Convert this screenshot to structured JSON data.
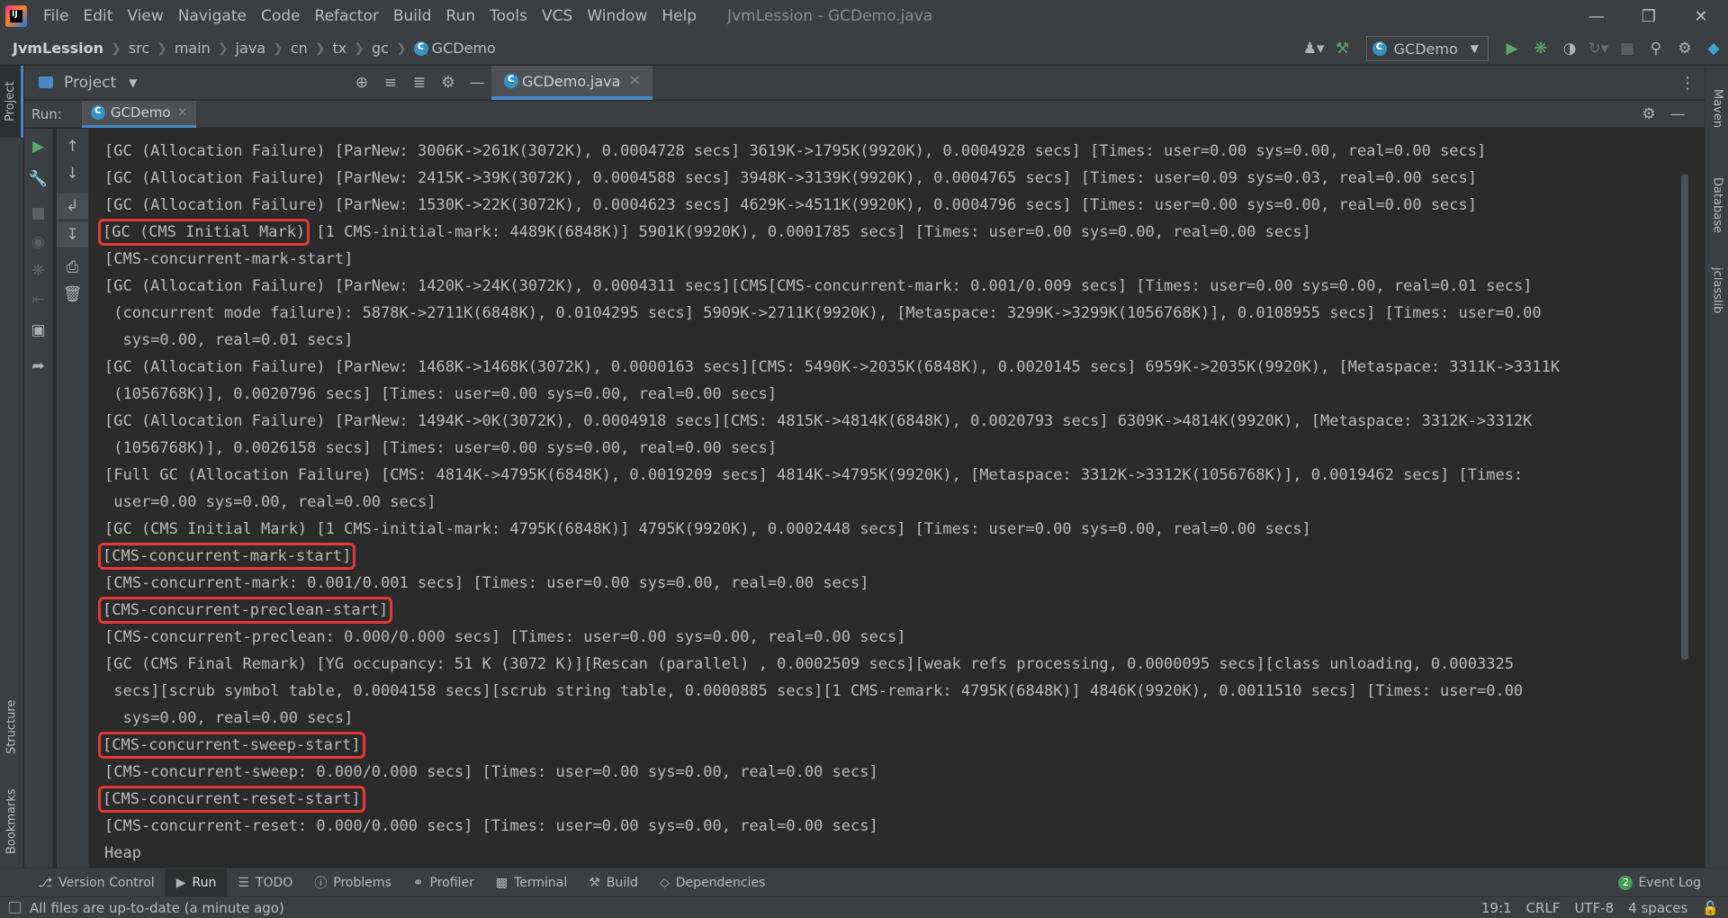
{
  "menu": [
    "File",
    "Edit",
    "View",
    "Navigate",
    "Code",
    "Refactor",
    "Build",
    "Run",
    "Tools",
    "VCS",
    "Window",
    "Help"
  ],
  "window_title": "JvmLession - GCDemo.java",
  "breadcrumb": [
    "JvmLession",
    "src",
    "main",
    "java",
    "cn",
    "tx",
    "gc",
    "GCDemo"
  ],
  "run_config": "GCDemo",
  "project_panel": {
    "title": "Project"
  },
  "editor": {
    "tab": "GCDemo.java"
  },
  "run_window": {
    "label": "Run:",
    "tab": "GCDemo"
  },
  "left_stripe": {
    "project": "Project",
    "structure": "Structure",
    "bookmarks": "Bookmarks"
  },
  "right_stripe": {
    "maven": "Maven",
    "database": "Database",
    "jclasslib": "jclasslib"
  },
  "console": {
    "lines": [
      "[GC (Allocation Failure) [ParNew: 3006K->261K(3072K), 0.0004728 secs] 3619K->1795K(9920K), 0.0004928 secs] [Times: user=0.00 sys=0.00, real=0.00 secs]",
      "[GC (Allocation Failure) [ParNew: 2415K->39K(3072K), 0.0004588 secs] 3948K->3139K(9920K), 0.0004765 secs] [Times: user=0.09 sys=0.03, real=0.00 secs]",
      "[GC (Allocation Failure) [ParNew: 1530K->22K(3072K), 0.0004623 secs] 4629K->4511K(9920K), 0.0004796 secs] [Times: user=0.00 sys=0.00, real=0.00 secs]",
      "[1 CMS-initial-mark: 4489K(6848K)] 5901K(9920K), 0.0001785 secs] [Times: user=0.00 sys=0.00, real=0.00 secs]",
      "[CMS-concurrent-mark-start]",
      "[GC (Allocation Failure) [ParNew: 1420K->24K(3072K), 0.0004311 secs][CMS[CMS-concurrent-mark: 0.001/0.009 secs] [Times: user=0.00 sys=0.00, real=0.01 secs]",
      " (concurrent mode failure): 5878K->2711K(6848K), 0.0104295 secs] 5909K->2711K(9920K), [Metaspace: 3299K->3299K(1056768K)], 0.0108955 secs] [Times: user=0.00",
      "  sys=0.00, real=0.01 secs]",
      "[GC (Allocation Failure) [ParNew: 1468K->1468K(3072K), 0.0000163 secs][CMS: 5490K->2035K(6848K), 0.0020145 secs] 6959K->2035K(9920K), [Metaspace: 3311K->3311K",
      " (1056768K)], 0.0020796 secs] [Times: user=0.00 sys=0.00, real=0.00 secs]",
      "[GC (Allocation Failure) [ParNew: 1494K->0K(3072K), 0.0004918 secs][CMS: 4815K->4814K(6848K), 0.0020793 secs] 6309K->4814K(9920K), [Metaspace: 3312K->3312K",
      " (1056768K)], 0.0026158 secs] [Times: user=0.00 sys=0.00, real=0.00 secs]",
      "[Full GC (Allocation Failure) [CMS: 4814K->4795K(6848K), 0.0019209 secs] 4814K->4795K(9920K), [Metaspace: 3312K->3312K(1056768K)], 0.0019462 secs] [Times:",
      " user=0.00 sys=0.00, real=0.00 secs]",
      "[GC (CMS Initial Mark) [1 CMS-initial-mark: 4795K(6848K)] 4795K(9920K), 0.0002448 secs] [Times: user=0.00 sys=0.00, real=0.00 secs]",
      "[CMS-concurrent-mark-start]",
      "[CMS-concurrent-mark: 0.001/0.001 secs] [Times: user=0.00 sys=0.00, real=0.00 secs]",
      "[CMS-concurrent-preclean-start]",
      "[CMS-concurrent-preclean: 0.000/0.000 secs] [Times: user=0.00 sys=0.00, real=0.00 secs]",
      "[GC (CMS Final Remark) [YG occupancy: 51 K (3072 K)][Rescan (parallel) , 0.0002509 secs][weak refs processing, 0.0000095 secs][class unloading, 0.0003325",
      " secs][scrub symbol table, 0.0004158 secs][scrub string table, 0.0000885 secs][1 CMS-remark: 4795K(6848K)] 4846K(9920K), 0.0011510 secs] [Times: user=0.00",
      "  sys=0.00, real=0.00 secs]",
      "[CMS-concurrent-sweep-start]",
      "[CMS-concurrent-sweep: 0.000/0.000 secs] [Times: user=0.00 sys=0.00, real=0.00 secs]",
      "[CMS-concurrent-reset-start]",
      "[CMS-concurrent-reset: 0.000/0.000 secs] [Times: user=0.00 sys=0.00, real=0.00 secs]",
      "Heap"
    ],
    "highlight_prefix_line4": "[GC (CMS Initial Mark)"
  },
  "bottom_tools": [
    "Version Control",
    "Run",
    "TODO",
    "Problems",
    "Profiler",
    "Terminal",
    "Build",
    "Dependencies"
  ],
  "event_log": {
    "label": "Event Log",
    "count": "2"
  },
  "status": {
    "message": "All files are up-to-date (a minute ago)",
    "position": "19:1",
    "line_sep": "CRLF",
    "encoding": "UTF-8",
    "indent": "4 spaces"
  },
  "colors": {
    "accent": "#4a88c7",
    "highlight": "#e53935",
    "run_green": "#59a869"
  }
}
